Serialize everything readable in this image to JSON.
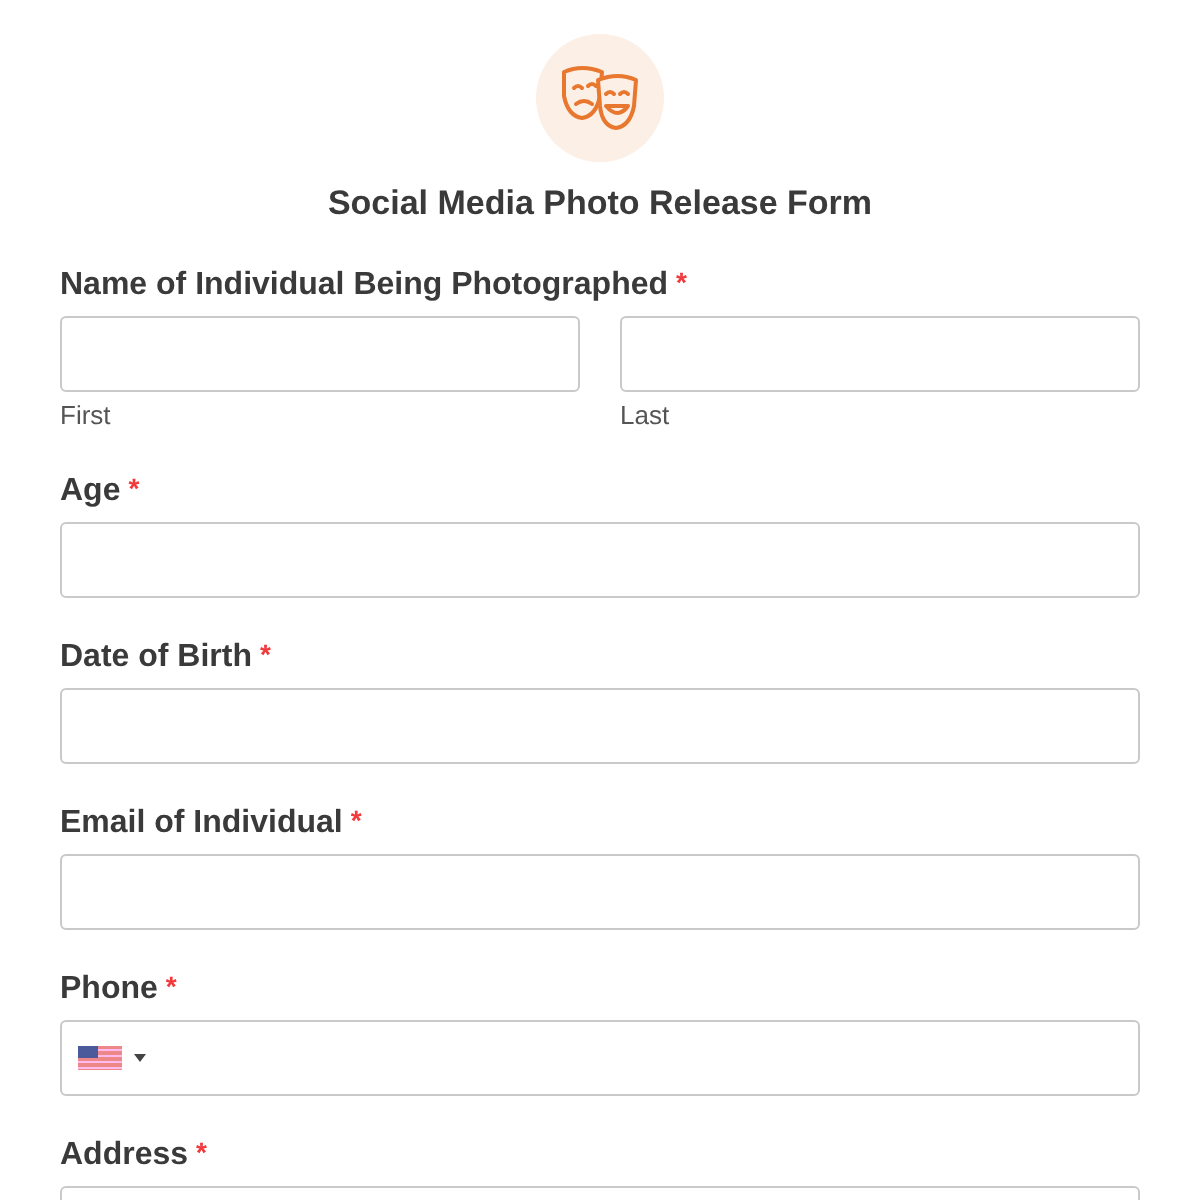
{
  "form": {
    "title": "Social Media Photo Release Form"
  },
  "fields": [
    {
      "kind": "name",
      "label": "Name of Individual Being Photographed",
      "required_mark": "*",
      "sublabels": [
        "First",
        "Last"
      ]
    },
    {
      "kind": "text",
      "label": "Age",
      "required_mark": "*"
    },
    {
      "kind": "text",
      "label": "Date of Birth",
      "required_mark": "*"
    },
    {
      "kind": "text",
      "label": "Email of Individual",
      "required_mark": "*"
    },
    {
      "kind": "phone",
      "label": "Phone",
      "required_mark": "*"
    },
    {
      "kind": "text",
      "label": "Address",
      "required_mark": "*"
    }
  ]
}
